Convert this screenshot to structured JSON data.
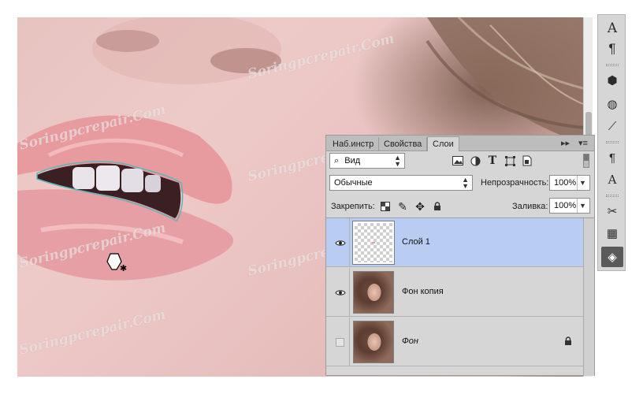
{
  "canvas": {
    "watermark_text": "Soringpcrepair.Com"
  },
  "tools": [
    {
      "name": "character-icon",
      "glyph": "A"
    },
    {
      "name": "paragraph-icon",
      "glyph": "¶"
    },
    {
      "name": "3d-cube-icon",
      "glyph": "⬢"
    },
    {
      "name": "adjustments-icon",
      "glyph": "◍"
    },
    {
      "name": "paths-icon",
      "glyph": "⟋"
    },
    {
      "name": "paragraph-styles-icon",
      "glyph": "¶"
    },
    {
      "name": "character-styles-icon",
      "glyph": "A"
    },
    {
      "name": "tool-presets-icon",
      "glyph": "✂"
    },
    {
      "name": "channels-icon",
      "glyph": "▦"
    },
    {
      "name": "layers-icon",
      "glyph": "◈"
    }
  ],
  "panel": {
    "tabs": [
      "Наб.инстр",
      "Свойства",
      "Слои"
    ],
    "active_tab": "Слои",
    "collapse_label": "▸▸",
    "menu_label": "▾≡",
    "filter": {
      "value": "Вид",
      "search_glyph": "⌕"
    },
    "blend_mode": "Обычные",
    "opacity_label": "Непрозрачность:",
    "opacity_value": "100%",
    "lock_label": "Закрепить:",
    "fill_label": "Заливка:",
    "fill_value": "100%",
    "layers": [
      {
        "name": "Слой 1",
        "visible": true,
        "selected": true,
        "thumb": "transparent",
        "locked": false,
        "italic": false
      },
      {
        "name": "Фон копия",
        "visible": true,
        "selected": false,
        "thumb": "photo",
        "locked": false,
        "italic": false
      },
      {
        "name": "Фон",
        "visible": false,
        "selected": false,
        "thumb": "photo",
        "locked": true,
        "italic": true
      }
    ]
  },
  "colors": {
    "selection_highlight": "#b9cdf3",
    "panel_bg": "#d6d6d6",
    "path_outline": "#5bb5b8"
  }
}
